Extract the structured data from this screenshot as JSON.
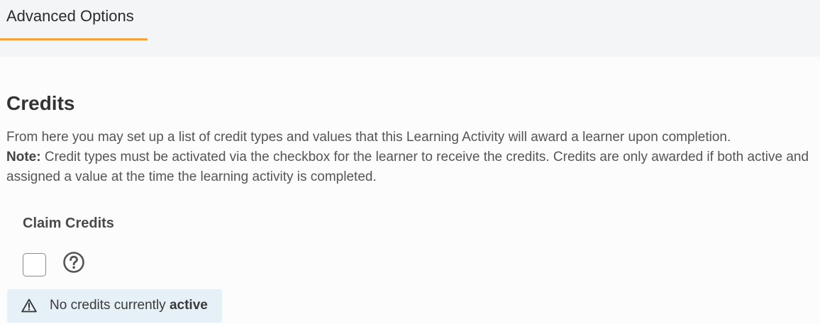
{
  "tabs": [
    {
      "label": "Advanced Options",
      "active": true
    }
  ],
  "section": {
    "title": "Credits",
    "description": "From here you may set up a list of credit types and values that this Learning Activity will award a learner upon completion.",
    "note_label": "Note:",
    "note_line1": " Credit types must be activated via the checkbox for the learner to receive the credits. Credits are only awarded if both active and",
    "note_line2": "assigned a value at the time the learning activity is completed."
  },
  "claim_credits": {
    "label": "Claim Credits",
    "checked": false,
    "help_icon": "question-circle-icon"
  },
  "notice": {
    "icon": "warning-triangle-icon",
    "text": "No credits currently ",
    "emphasis": "active"
  },
  "colors": {
    "tab_underline": "#f5a13a",
    "tab_bar_bg": "#f4f5f7",
    "notice_bg": "#e6f0f7"
  }
}
